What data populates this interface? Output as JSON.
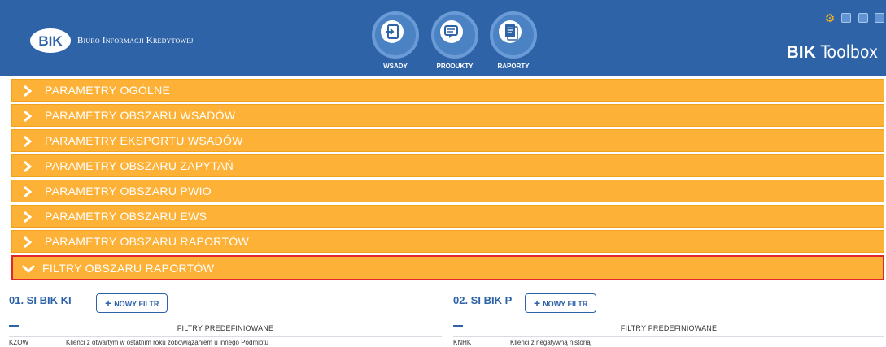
{
  "header": {
    "logo_text": "BIK",
    "company_name": "Biuro Informacji Kredytowej",
    "brand_bold": "BIK",
    "brand_light": "Toolbox",
    "nav": [
      {
        "label": "WSADY",
        "icon": "import-icon"
      },
      {
        "label": "PRODUKTY",
        "icon": "chat-icon"
      },
      {
        "label": "RAPORTY",
        "icon": "report-icon"
      }
    ],
    "window_controls": [
      "gear-icon",
      "minimize-icon",
      "maximize-icon",
      "close-icon"
    ]
  },
  "colors": {
    "header_bg": "#2e63a8",
    "accordion_bg": "#fdb136",
    "active_outline": "#e0262b",
    "accent": "#2e63a8"
  },
  "accordion": [
    {
      "label": "PARAMETRY OGÓLNE",
      "expanded": false
    },
    {
      "label": "PARAMETRY OBSZARU WSADÓW",
      "expanded": false
    },
    {
      "label": "PARAMETRY EKSPORTU WSADÓW",
      "expanded": false
    },
    {
      "label": "PARAMETRY OBSZARU ZAPYTAŃ",
      "expanded": false
    },
    {
      "label": "PARAMETRY OBSZARU PWIO",
      "expanded": false
    },
    {
      "label": "PARAMETRY OBSZARU EWS",
      "expanded": false
    },
    {
      "label": "PARAMETRY OBSZARU RAPORTÓW",
      "expanded": false
    },
    {
      "label": "FILTRY OBSZARU RAPORTÓW",
      "expanded": true
    }
  ],
  "filters": [
    {
      "title": "01. SI BIK KI",
      "new_filter_label": "NOWY FILTR",
      "table_header": "FILTRY PREDEFINIOWANE",
      "rows": [
        {
          "code": "KZOW",
          "desc": "Klienci z otwartym w ostatnim roku zobowiązaniem u innego Podmiotu"
        }
      ]
    },
    {
      "title": "02. SI BIK P",
      "new_filter_label": "NOWY FILTR",
      "table_header": "FILTRY PREDEFINIOWANE",
      "rows": [
        {
          "code": "KNHK",
          "desc": "Klienci z negatywną historią"
        }
      ]
    }
  ]
}
